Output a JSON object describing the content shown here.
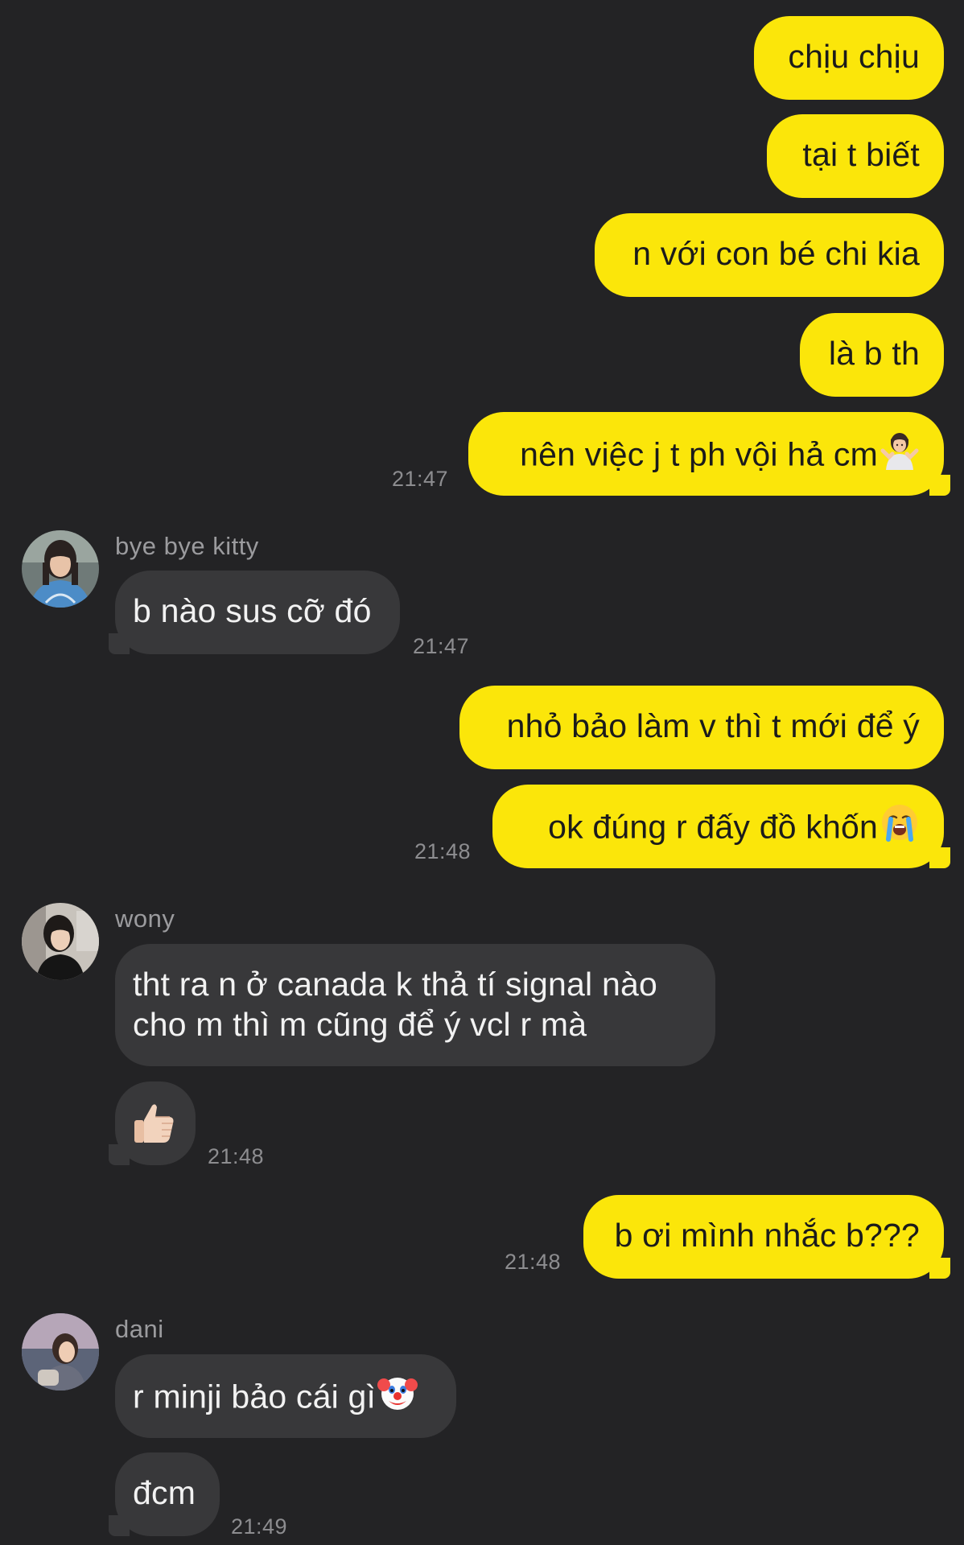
{
  "messages": {
    "m1": "chịu chịu",
    "m2": "tại t biết",
    "m3": "n với con bé chi kia",
    "m4": "là b th",
    "m5": "nên việc j t ph vội hả cm",
    "m5_time": "21:47",
    "m6_sender": "bye bye kitty",
    "m6": "b nào sus cỡ đó",
    "m6_time": "21:47",
    "m7": "nhỏ bảo làm v thì t mới để ý",
    "m8": "ok đúng r đấy đồ khốn",
    "m8_time": "21:48",
    "m9_sender": "wony",
    "m9": "tht ra n ở canada k thả tí signal nào cho m thì m cũng để ý vcl r mà",
    "m10_time": "21:48",
    "m11": "b ơi mình nhắc b???",
    "m11_time": "21:48",
    "m12_sender": "dani",
    "m12": "r minji bảo cái gì",
    "m13": "đcm",
    "m13_time": "21:49"
  },
  "emojis": {
    "m5": "person-shrugging-emoji",
    "m8": "loudly-crying-face-emoji",
    "m10": "thumbs-up-emoji",
    "m12": "clown-face-emoji"
  },
  "colors": {
    "background": "#232325",
    "my_bubble": "#FBE60A",
    "their_bubble": "#38383a",
    "timestamp": "#8d8d90"
  }
}
